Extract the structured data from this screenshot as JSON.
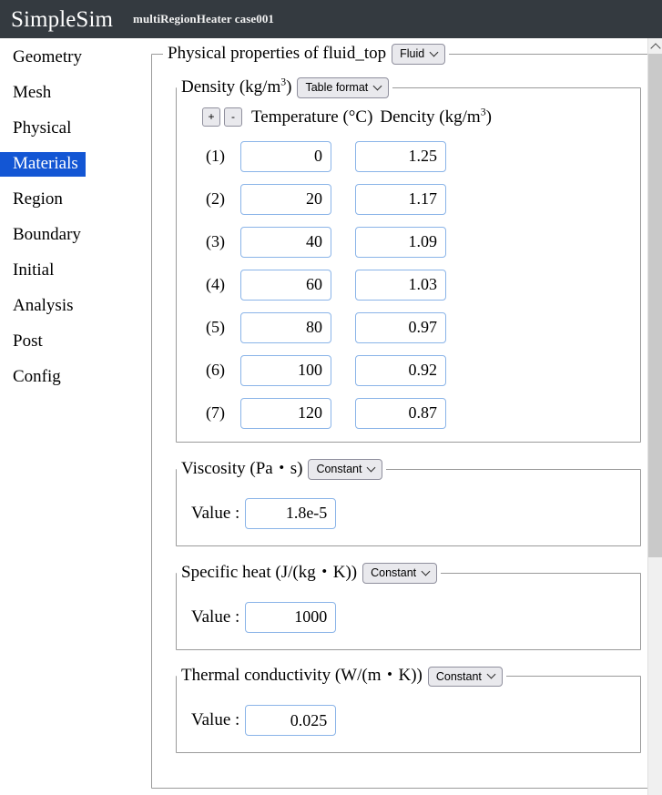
{
  "header": {
    "title": "SimpleSim",
    "subtitle": "multiRegionHeater case001",
    "background": "#343a40"
  },
  "sidebar": {
    "selected": "Materials",
    "accent": "#1356d4",
    "items": [
      {
        "label": "Geometry"
      },
      {
        "label": "Mesh"
      },
      {
        "label": "Physical"
      },
      {
        "label": "Materials"
      },
      {
        "label": "Region"
      },
      {
        "label": "Boundary"
      },
      {
        "label": "Initial"
      },
      {
        "label": "Analysis"
      },
      {
        "label": "Post"
      },
      {
        "label": "Config"
      }
    ]
  },
  "main": {
    "panel": {
      "legend": "Physical properties of fluid_top",
      "material_type": "Fluid"
    },
    "density": {
      "legend_prefix": "Density (kg/m",
      "legend_exp": "3",
      "legend_suffix": ")",
      "format": "Table format",
      "add_button": "+",
      "remove_button": "-",
      "col_temperature": "Temperature (°C)",
      "col_density_prefix": "Dencity (kg/m",
      "col_density_exp": "3",
      "col_density_suffix": ")",
      "rows": [
        {
          "index": "(1)",
          "temperature": "0",
          "density": "1.25"
        },
        {
          "index": "(2)",
          "temperature": "20",
          "density": "1.17"
        },
        {
          "index": "(3)",
          "temperature": "40",
          "density": "1.09"
        },
        {
          "index": "(4)",
          "temperature": "60",
          "density": "1.03"
        },
        {
          "index": "(5)",
          "temperature": "80",
          "density": "0.97"
        },
        {
          "index": "(6)",
          "temperature": "100",
          "density": "0.92"
        },
        {
          "index": "(7)",
          "temperature": "120",
          "density": "0.87"
        }
      ]
    },
    "viscosity": {
      "legend": "Viscosity (Pa・s)",
      "format": "Constant",
      "value_label": "Value :",
      "value": "1.8e-5"
    },
    "specific_heat": {
      "legend": "Specific heat (J/(kg・K))",
      "format": "Constant",
      "value_label": "Value :",
      "value": "1000"
    },
    "thermal_conductivity": {
      "legend": "Thermal conductivity (W/(m・K))",
      "format": "Constant",
      "value_label": "Value :",
      "value": "0.025"
    }
  },
  "scrollbar": {
    "up_arrow": "scroll-up-arrow"
  }
}
